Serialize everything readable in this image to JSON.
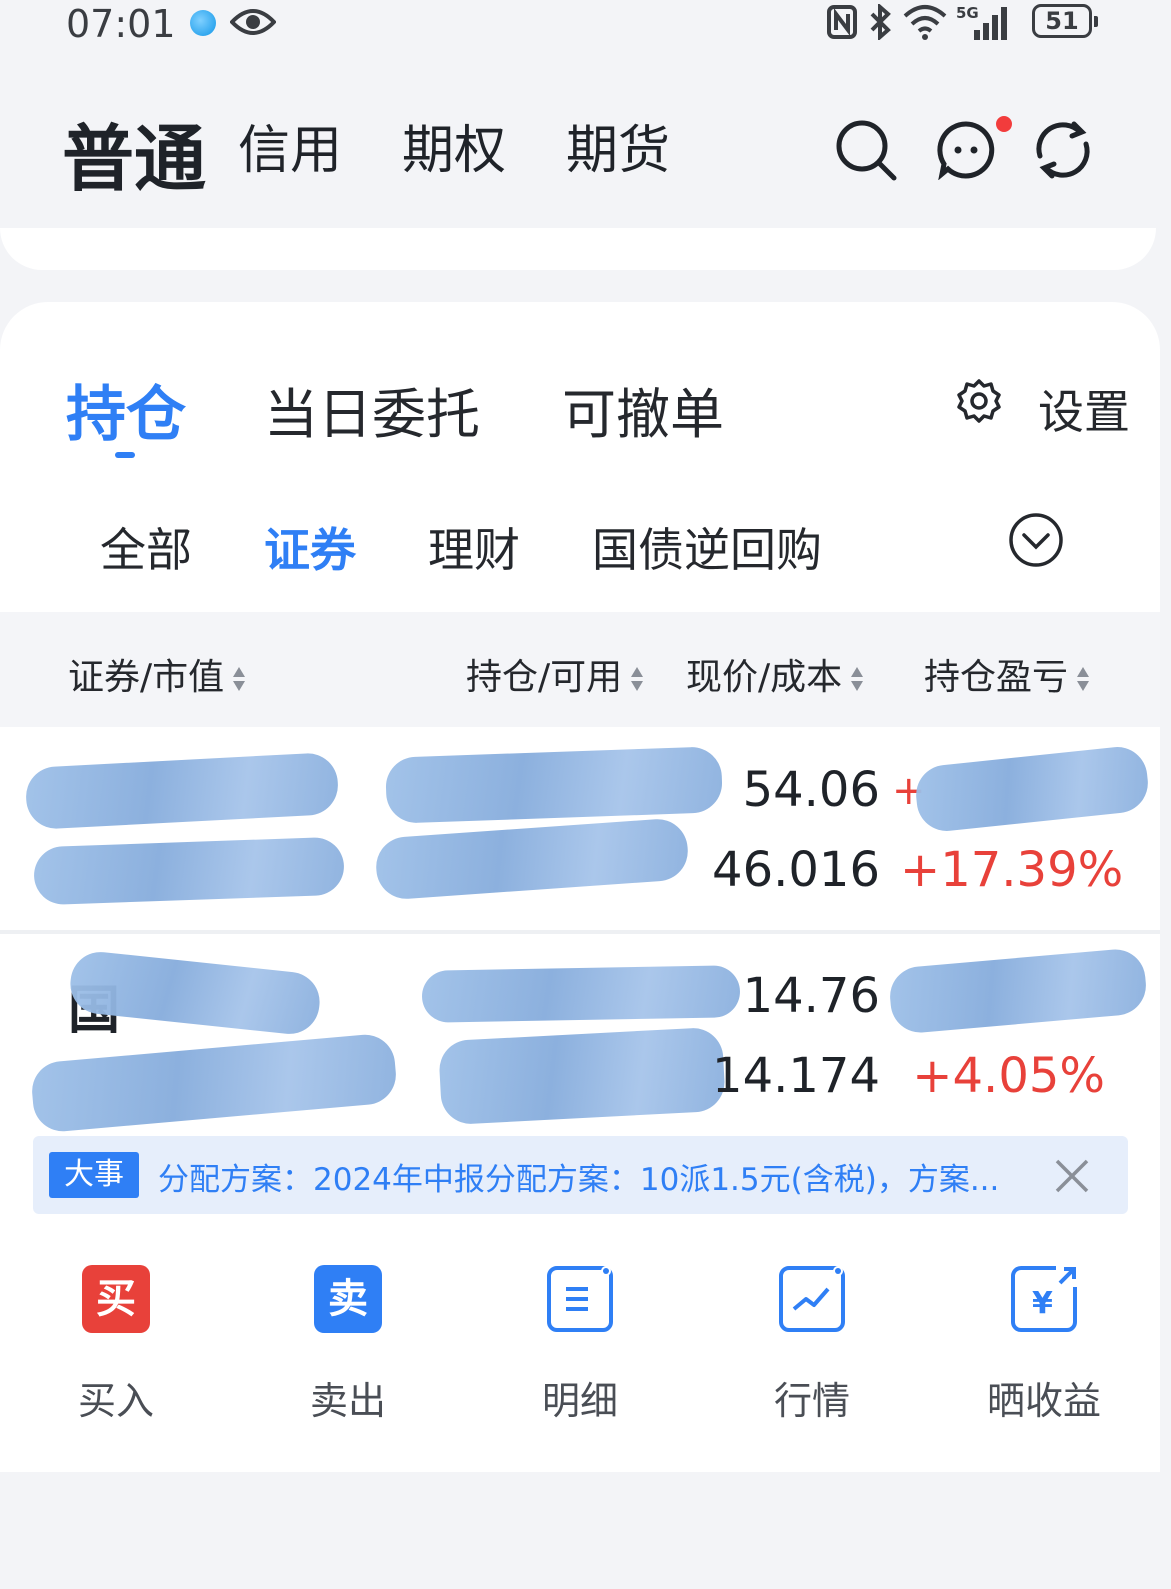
{
  "status_bar": {
    "time": "07:01",
    "battery": "51",
    "network": "5G"
  },
  "account_tabs": [
    "普通",
    "信用",
    "期权",
    "期货"
  ],
  "section_tabs": [
    "持仓",
    "当日委托",
    "可撤单"
  ],
  "settings_label": "设置",
  "filter_tabs": [
    "全部",
    "证券",
    "理财",
    "国债逆回购"
  ],
  "columns": [
    "证券/市值",
    "持仓/可用",
    "现价/成本",
    "持仓盈亏"
  ],
  "positions": [
    {
      "price": "54.06",
      "cost": "46.016",
      "pnl_sign": "+",
      "pnl_pct": "+17.39%"
    },
    {
      "name_partial": "国",
      "price": "14.76",
      "cost": "14.174",
      "pnl_pct": "+4.05%"
    }
  ],
  "news": {
    "tag": "大事",
    "text": "分配方案：2024年中报分配方案：10派1.5元(含税)，方案..."
  },
  "actions": [
    {
      "icon": "buy-icon",
      "glyph": "买",
      "label": "买入"
    },
    {
      "icon": "sell-icon",
      "glyph": "卖",
      "label": "卖出"
    },
    {
      "icon": "details-icon",
      "label": "明细"
    },
    {
      "icon": "market-chart-icon",
      "label": "行情"
    },
    {
      "icon": "share-profit-icon",
      "glyph": "¥",
      "label": "晒收益"
    }
  ],
  "colors": {
    "accent": "#2f7ff5",
    "up": "#e8413a",
    "buy": "#e8413a",
    "sell": "#2f7ff5"
  }
}
